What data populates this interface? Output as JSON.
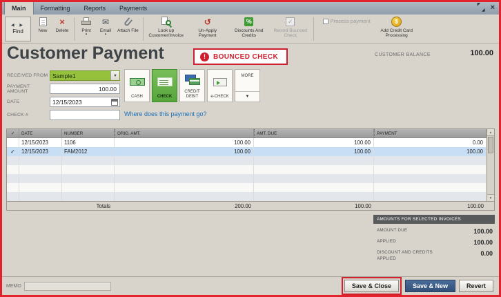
{
  "tabs": {
    "main": "Main",
    "formatting": "Formatting",
    "reports": "Reports",
    "payments": "Payments"
  },
  "toolbar": {
    "find": "Find",
    "new": "New",
    "delete": "Delete",
    "print": "Print",
    "email": "Email",
    "attach": "Attach File",
    "lookup": "Look up Customer/Invoice",
    "unapply": "Un-Apply Payment",
    "discounts": "Discounts And Credits",
    "bounced": "Record Bounced Check",
    "process_payment": "Process payment",
    "add_cc": "Add Credit Card Processing"
  },
  "header": {
    "title": "Customer Payment",
    "alert": "BOUNCED CHECK",
    "balance_label": "CUSTOMER BALANCE",
    "balance_value": "100.00"
  },
  "form": {
    "received_from_label": "RECEIVED FROM",
    "received_from_value": "Sample1",
    "payment_amount_label": "PAYMENT AMOUNT",
    "payment_amount_value": "100.00",
    "date_label": "DATE",
    "date_value": "12/15/2023",
    "check_number_label": "CHECK #",
    "check_number_value": "",
    "link": "Where does this payment go?"
  },
  "methods": {
    "cash": "CASH",
    "check": "CHECK",
    "credit": "CREDIT DEBIT",
    "echeck": "e-CHECK",
    "more": "MORE"
  },
  "table": {
    "check_header": "✓",
    "headers": {
      "date": "DATE",
      "number": "NUMBER",
      "orig": "ORIG. AMT.",
      "due": "AMT. DUE",
      "payment": "PAYMENT"
    },
    "rows": [
      {
        "check": "",
        "date": "12/15/2023",
        "number": "1106",
        "orig": "100.00",
        "due": "100.00",
        "payment": "0.00"
      },
      {
        "check": "✓",
        "date": "12/15/2023",
        "number": "FAM2012",
        "orig": "100.00",
        "due": "100.00",
        "payment": "100.00"
      }
    ],
    "totals_label": "Totals",
    "totals": {
      "orig": "200.00",
      "due": "100.00",
      "payment": "100.00"
    }
  },
  "summary": {
    "title": "AMOUNTS FOR SELECTED INVOICES",
    "amount_due_label": "AMOUNT DUE",
    "amount_due_value": "100.00",
    "applied_label": "APPLIED",
    "applied_value": "100.00",
    "discount_label": "DISCOUNT AND CREDITS APPLIED",
    "discount_value": "0.00"
  },
  "footer": {
    "memo_label": "MEMO",
    "save_close": "Save & Close",
    "save_new": "Save & New",
    "revert": "Revert"
  },
  "icons": {
    "find_prev": "◀",
    "find_next": "▶",
    "dropdown": "▾",
    "combo": "▼",
    "delete": "×",
    "email": "✉",
    "unapply": "↺",
    "percent": "%",
    "dollar": "$",
    "alert": "!",
    "check": "✓",
    "up": "▲",
    "down": "▼",
    "close": "×",
    "expand_tl": "◤",
    "expand_br": "◢"
  }
}
